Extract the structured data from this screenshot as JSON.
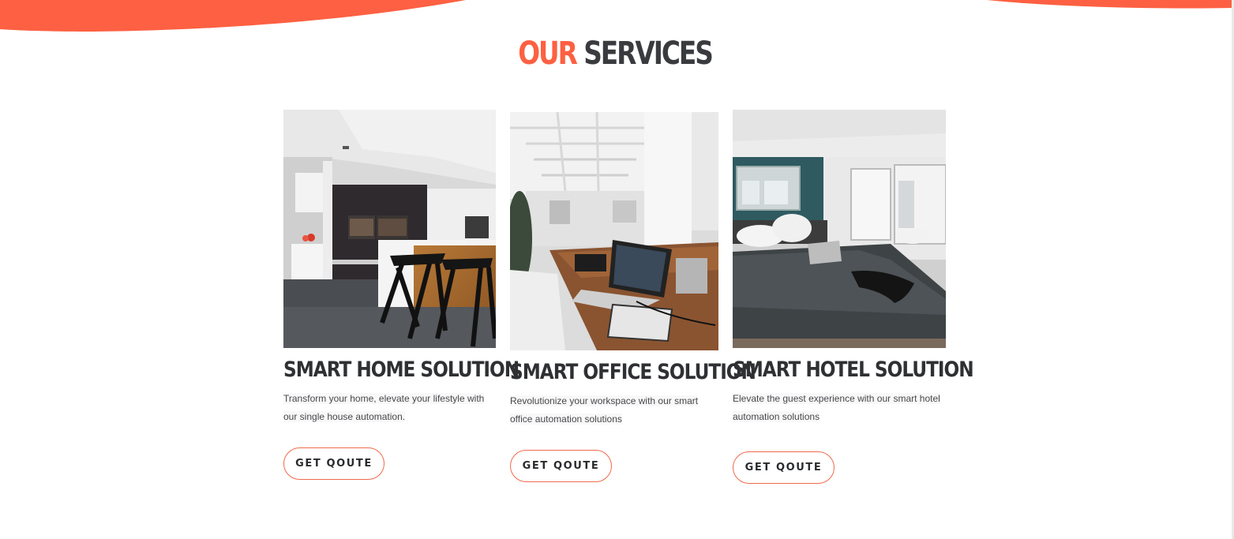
{
  "section": {
    "title_accent": "OUR",
    "title_rest": "SERVICES"
  },
  "colors": {
    "accent": "#fd6042",
    "heading": "#3a3b3f",
    "text": "#47484c"
  },
  "services": [
    {
      "title": "SMART HOME SOLUTION",
      "description_line1": "Transform your home, elevate your lifestyle with",
      "description_line2": "our single house automation.",
      "button_label": "GET QOUTE",
      "image": "modern-kitchen-photo"
    },
    {
      "title": "SMART OFFICE SOLUTION",
      "description_line1": "Revolutionize your workspace with our smart",
      "description_line2": "office automation solutions",
      "button_label": "GET QOUTE",
      "image": "office-desk-laptop-photo"
    },
    {
      "title": "SMART HOTEL SOLUTION",
      "description_line1": "Elevate the guest experience with our smart hotel",
      "description_line2": "automation solutions",
      "button_label": "GET QOUTE",
      "image": "hotel-bedroom-photo"
    }
  ]
}
